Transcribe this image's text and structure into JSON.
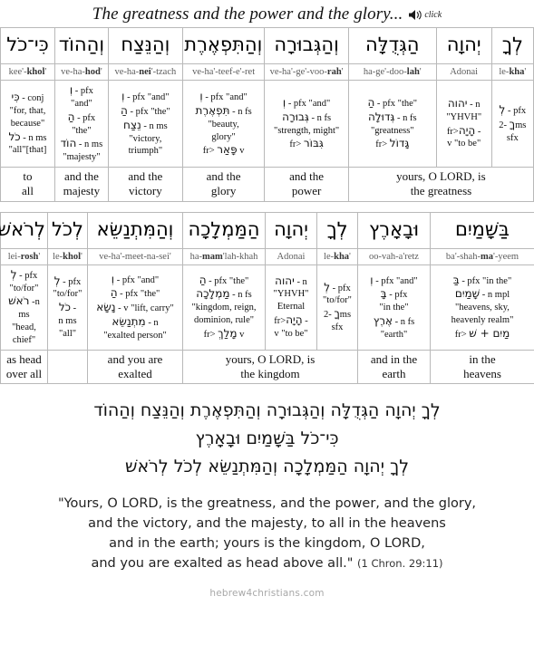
{
  "header": {
    "title": "The greatness and the power and the glory...",
    "audio_label": "click",
    "audio_icon": "speaker-icon"
  },
  "row1": {
    "columns": [
      {
        "hebrew": "כִּי־כֹל",
        "translit_pre": "kee'-",
        "translit_bold": "khol",
        "translit_post": "'",
        "parse": [
          {
            "heb": "כִּי",
            "text": " - conj"
          },
          {
            "heb": "",
            "text": "\"for, that,"
          },
          {
            "heb": "",
            "text": "because\""
          },
          {
            "heb": "כֹל",
            "text": " - n ms"
          },
          {
            "heb": "",
            "text": "\"all\"[that]"
          }
        ],
        "english": "to\nall"
      },
      {
        "hebrew": "וְהַהוֹד",
        "translit_pre": "ve-ha-",
        "translit_bold": "hod",
        "translit_post": "'",
        "parse": [
          {
            "heb": "וְ",
            "text": " - pfx"
          },
          {
            "heb": "",
            "text": "\"and\""
          },
          {
            "heb": "הַ",
            "text": " - pfx \"the\""
          },
          {
            "heb": "הוֹד",
            "text": " - n ms"
          },
          {
            "heb": "",
            "text": "\"majesty\""
          }
        ],
        "english": "and the\nmajesty"
      },
      {
        "hebrew": "וְהַנֵּצַח",
        "translit_pre": "ve-ha-",
        "translit_bold": "nei",
        "translit_post": "'-tzach",
        "parse": [
          {
            "heb": "וְ",
            "text": " - pfx \"and\""
          },
          {
            "heb": "הַ",
            "text": " - pfx \"the\""
          },
          {
            "heb": "נֵצַח",
            "text": " - n ms"
          },
          {
            "heb": "",
            "text": "\"victory,"
          },
          {
            "heb": "",
            "text": "triumph\""
          }
        ],
        "english": "and the\nvictory"
      },
      {
        "hebrew": "וְהַתִּפְאֶרֶת",
        "translit_pre": "ve-ha'-teef-e'-ret",
        "translit_bold": "",
        "translit_post": "",
        "parse": [
          {
            "heb": "וְ",
            "text": " - pfx \"and\""
          },
          {
            "heb": "תִּפְאֶרֶת",
            "text": " - n fs"
          },
          {
            "heb": "",
            "text": "\"beauty,"
          },
          {
            "heb": "",
            "text": "glory\""
          },
          {
            "heb": "פָּאַר",
            "text": " v",
            "prefix": "fr> "
          }
        ],
        "english": "and the\nglory"
      },
      {
        "hebrew": "וְהַגְּבוּרָה",
        "translit_pre": "ve-ha'-ge'-voo-",
        "translit_bold": "rah",
        "translit_post": "'",
        "parse": [
          {
            "heb": "וְ",
            "text": " - pfx \"and\""
          },
          {
            "heb": "גְּבוּרָה",
            "text": " - n fs"
          },
          {
            "heb": "",
            "text": "\"strength, might\""
          },
          {
            "heb": "גִּבּוֹר",
            "text": "",
            "prefix": "fr> "
          }
        ],
        "english": "and the\npower"
      },
      {
        "hebrew": "הַגְּדֻלָּה",
        "translit_pre": "ha-ge'-doo-",
        "translit_bold": "lah",
        "translit_post": "'",
        "parse": [
          {
            "heb": "הַ",
            "text": " - pfx \"the\""
          },
          {
            "heb": "גְּדוּלָה",
            "text": " - n fs"
          },
          {
            "heb": "",
            "text": "\"greatness\""
          },
          {
            "heb": "גָּדוֹל",
            "text": "",
            "prefix": "fr> "
          }
        ],
        "english": ""
      },
      {
        "hebrew": "יְהוָה",
        "translit_pre": "Adonai",
        "translit_bold": "",
        "translit_post": "",
        "parse": [
          {
            "heb": "יהוה",
            "text": " - n"
          },
          {
            "heb": "",
            "text": "\"YHVH\""
          },
          {
            "heb": "הָיָה",
            "text": " -",
            "prefix": "fr>"
          },
          {
            "heb": "",
            "text": "v \"to be\""
          }
        ],
        "english": ""
      },
      {
        "hebrew": "לְךָ",
        "translit_pre": "le-",
        "translit_bold": "kha",
        "translit_post": "'",
        "parse": [
          {
            "heb": "לְ",
            "text": " - pfx"
          },
          {
            "heb": "ךָ",
            "text": " -2ms"
          },
          {
            "heb": "",
            "text": "sfx"
          }
        ],
        "english": ""
      }
    ],
    "english_merged_right": "yours, O LORD, is\nthe greatness"
  },
  "row2": {
    "columns": [
      {
        "hebrew": "לְרֹאשׁ",
        "translit_pre": "lei-",
        "translit_bold": "rosh",
        "translit_post": "'",
        "parse": [
          {
            "heb": "לְ",
            "text": " - pfx"
          },
          {
            "heb": "",
            "text": "\"to/for\""
          },
          {
            "heb": "רֹאשׁ",
            "text": " -n"
          },
          {
            "heb": "",
            "text": "ms"
          },
          {
            "heb": "",
            "text": "\"head,"
          },
          {
            "heb": "",
            "text": "chief\""
          }
        ],
        "english": "as head\nover all"
      },
      {
        "hebrew": "לְכֹל",
        "translit_pre": "le-",
        "translit_bold": "khol",
        "translit_post": "'",
        "parse": [
          {
            "heb": "לְ",
            "text": " - pfx"
          },
          {
            "heb": "",
            "text": "\"to/for\""
          },
          {
            "heb": "כֹל",
            "text": " -"
          },
          {
            "heb": "",
            "text": "n ms"
          },
          {
            "heb": "",
            "text": "\"all\""
          }
        ],
        "english": ""
      },
      {
        "hebrew": "וְהַמִּתְנַשֵּׂא",
        "translit_pre": "ve-ha'-meet-na-sei'",
        "translit_bold": "",
        "translit_post": "",
        "parse": [
          {
            "heb": "וְ",
            "text": " - pfx \"and\""
          },
          {
            "heb": "הַ",
            "text": " - pfx \"the\""
          },
          {
            "heb": "נָשָׂא",
            "text": " - v \"lift, carry\""
          },
          {
            "heb": "מִתְנַשֵּׂא",
            "text": " - n"
          },
          {
            "heb": "",
            "text": "\"exalted person\""
          }
        ],
        "english": "and you are\nexalted"
      },
      {
        "hebrew": "הַמַּמְלָכָה",
        "translit_pre": "ha-",
        "translit_bold": "mam",
        "translit_post": "'lah-khah",
        "parse": [
          {
            "heb": "הַ",
            "text": " - pfx \"the\""
          },
          {
            "heb": "מַמְלָכָה",
            "text": " - n fs"
          },
          {
            "heb": "",
            "text": "\"kingdom, reign,"
          },
          {
            "heb": "",
            "text": "dominion, rule\""
          },
          {
            "heb": "מָלַךְ",
            "text": " v",
            "prefix": "fr> "
          }
        ],
        "english": "yours, O LORD, is\nthe kingdom"
      },
      {
        "hebrew": "יְהוָה",
        "translit_pre": "Adonai",
        "translit_bold": "",
        "translit_post": "",
        "parse": [
          {
            "heb": "יהוה",
            "text": " - n"
          },
          {
            "heb": "",
            "text": "\"YHVH\""
          },
          {
            "heb": "",
            "text": "Eternal"
          },
          {
            "heb": "הָיָה",
            "text": " -",
            "prefix": "fr>"
          },
          {
            "heb": "",
            "text": "v \"to be\""
          }
        ],
        "english": ""
      },
      {
        "hebrew": "לְךָ",
        "translit_pre": "le-",
        "translit_bold": "kha",
        "translit_post": "'",
        "parse": [
          {
            "heb": "לְ",
            "text": " - pfx"
          },
          {
            "heb": "",
            "text": "\"to/for\""
          },
          {
            "heb": "ךָ",
            "text": " -2ms"
          },
          {
            "heb": "",
            "text": "sfx"
          }
        ],
        "english": ""
      },
      {
        "hebrew": "וּבָאָרֶץ",
        "translit_pre": "oo-vah-a'retz",
        "translit_bold": "",
        "translit_post": "",
        "parse": [
          {
            "heb": "וְ",
            "text": " - pfx \"and\""
          },
          {
            "heb": "בָּ",
            "text": " - pfx"
          },
          {
            "heb": "",
            "text": "\"in the\""
          },
          {
            "heb": "אֶרֶץ",
            "text": " - n fs"
          },
          {
            "heb": "",
            "text": "\"earth\""
          }
        ],
        "english": "and in the\nearth"
      },
      {
        "hebrew": "בַּשָּׁמַיִם",
        "translit_pre": "ba'-shah-",
        "translit_bold": "ma",
        "translit_post": "'-yeem",
        "parse": [
          {
            "heb": "בַּ",
            "text": " - pfx \"in the\""
          },
          {
            "heb": "שָׁמַיִם",
            "text": " - n mpl"
          },
          {
            "heb": "",
            "text": "\"heavens, sky,"
          },
          {
            "heb": "",
            "text": "heavenly realm\""
          },
          {
            "heb": "מַיִם + שׁ",
            "text": "",
            "prefix": "fr> "
          }
        ],
        "english": "in the\nheavens"
      }
    ]
  },
  "verse": {
    "hebrew_lines": [
      "לְךָ יְהוָה הַגְּדֻלָּה וְהַגְּבוּרָה וְהַתִּפְאֶרֶת וְהַנֵּצַח וְהַהוֹד",
      "כִּי־כֹל בַּשָּׁמַיִם וּבָאָרֶץ",
      "לְךָ יְהוָה הַמַּמְלָכָה וְהַמִּתְנַשֵּׂא לְכֹל לְרֹאשׁ"
    ],
    "english_lines": [
      "\"Yours, O LORD, is the greatness, and the power, and the glory,",
      "and the victory, and the majesty, to all in the heavens",
      "and in the earth; yours is the kingdom, O LORD,",
      "and you are exalted as head above all.\""
    ],
    "reference": "(1 Chron. 29:11)"
  },
  "footer": {
    "site": "hebrew4christians.com"
  }
}
